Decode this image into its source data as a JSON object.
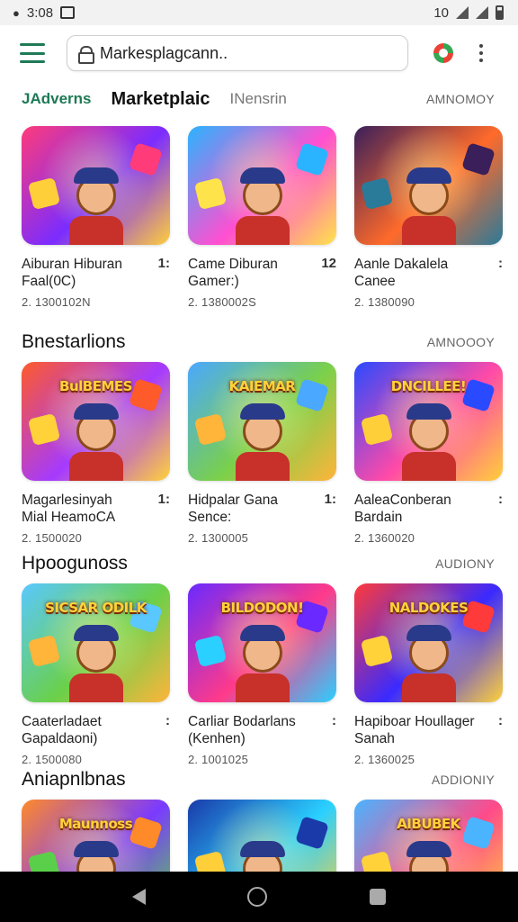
{
  "status_bar": {
    "time": "3:08",
    "battery_text": "10"
  },
  "header": {
    "url": "Markesplagcann..",
    "icons": [
      "menu-icon",
      "lock-icon",
      "play-store-icon",
      "more-vert-icon"
    ]
  },
  "tabs": {
    "items": [
      "JAdverns",
      "Marketplaic",
      "INensrin"
    ],
    "more": "AMNOMOY"
  },
  "sections": [
    {
      "title": "",
      "more": "",
      "cards": [
        {
          "title": "Aiburan Hiburan",
          "sub": "Faal(0C)",
          "menu": "1:",
          "stat": "2. 1300102N",
          "badge": "",
          "colors": [
            "#ff3b7a",
            "#7b2cff",
            "#ffcf3a"
          ]
        },
        {
          "title": "Came Diburan",
          "sub": "Gamer:)",
          "menu": "12",
          "stat": "2. 1380002S",
          "badge": "",
          "colors": [
            "#2ab4ff",
            "#ff4fd1",
            "#ffe34a"
          ]
        },
        {
          "title": "Aanle Dakalela",
          "sub": "Canee",
          "menu": ":",
          "stat": "2. 1380090",
          "badge": "",
          "colors": [
            "#3a1f5a",
            "#ff6a2a",
            "#2a7a9a"
          ]
        }
      ]
    },
    {
      "title": "Bnestarlions",
      "more": "AMNOOOY",
      "cards": [
        {
          "title": "Magarlesinyah",
          "sub": "Mial HeamoCA",
          "menu": "1:",
          "stat": "2. 1500020",
          "badge": "BulBEMES",
          "colors": [
            "#ff5a2a",
            "#a53aff",
            "#ffd23a"
          ]
        },
        {
          "title": "Hidpalar Gana",
          "sub": "Sence:",
          "menu": "1:",
          "stat": "2. 1300005",
          "badge": "KAIEMAR",
          "colors": [
            "#4aa8ff",
            "#7ad04a",
            "#ffb43a"
          ]
        },
        {
          "title": "AaleaConberan",
          "sub": "Bardain",
          "menu": ":",
          "stat": "2. 1360020",
          "badge": "DNCILLEE!",
          "colors": [
            "#2a4aff",
            "#ff4aa8",
            "#ffcf3a"
          ]
        }
      ]
    },
    {
      "title": "Hpoogunoss",
      "more": "AUDIONY",
      "cards": [
        {
          "title": "Caaterladaet",
          "sub": "Gapaldaoni)",
          "menu": ":",
          "stat": "2. 1500080",
          "badge": "SICSAR ODILK",
          "colors": [
            "#5ac8ff",
            "#6ad04a",
            "#ffb43a"
          ]
        },
        {
          "title": "Carliar Bodarlans",
          "sub": "(Kenhen)",
          "menu": ":",
          "stat": "2. 1001025",
          "badge": "BILDODON!",
          "colors": [
            "#6a2aff",
            "#ff3a8a",
            "#2ad0ff"
          ]
        },
        {
          "title": "Hapiboar Houllager",
          "sub": "Sanah",
          "menu": ":",
          "stat": "2. 1360025",
          "badge": "NALDOKES",
          "colors": [
            "#ff3a3a",
            "#3a2aff",
            "#ffd23a"
          ]
        }
      ]
    },
    {
      "title": "Aniapnlbnas",
      "more": "ADDIONIY",
      "cards": [
        {
          "title": "",
          "sub": "",
          "menu": "",
          "stat": "",
          "badge": "Maunnoss",
          "colors": [
            "#ff8a2a",
            "#7a3aff",
            "#5ad04a"
          ]
        },
        {
          "title": "",
          "sub": "",
          "menu": "",
          "stat": "",
          "badge": "",
          "colors": [
            "#1a3aaa",
            "#2ad0ff",
            "#ffcf3a"
          ]
        },
        {
          "title": "",
          "sub": "",
          "menu": "",
          "stat": "",
          "badge": "AIBUBEK",
          "colors": [
            "#4ab4ff",
            "#ff4a8a",
            "#ffd23a"
          ]
        }
      ]
    }
  ]
}
